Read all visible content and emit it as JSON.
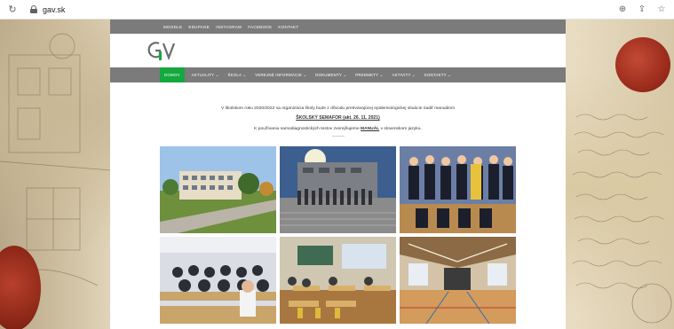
{
  "browser": {
    "url": "gav.sk",
    "icons": [
      "reload-icon",
      "lock-icon",
      "zoom-icon",
      "share-icon",
      "bookmark-star-icon"
    ]
  },
  "site": {
    "topbar_links": [
      "MOODLE",
      "EDUPAGE",
      "INSTAGRAM",
      "FACEBOOK",
      "KONTAKT"
    ],
    "logo_text": "GAV",
    "nav": [
      {
        "label": "DOMOV",
        "active": true
      },
      {
        "label": "AKTUALITY ⌄",
        "active": false
      },
      {
        "label": "ŠKOLA ⌄",
        "active": false
      },
      {
        "label": "VEREJNÉ INFORMÁCIE ⌄",
        "active": false
      },
      {
        "label": "DOKUMENTY ⌄",
        "active": false
      },
      {
        "label": "PREDMETY ⌄",
        "active": false
      },
      {
        "label": "AKTIVITY ⌄",
        "active": false
      },
      {
        "label": "KONTAKTY ⌄",
        "active": false
      }
    ],
    "announcement": {
      "line1": "V školskom roku 2020/2022 sa organizácia školy bude z dôvodu pretrvávajúcej epidemiologickej situácie riadiť manuálom",
      "line2": "ŠKOLSKÝ SEMAFOR (akt. 26. 11. 2021)",
      "line3_prefix": "K používaniu samodiagnostických testov zverejňujeme ",
      "line3_link": "MANUÁL",
      "line3_suffix": " v slovenskom jazyku."
    },
    "gallery": [
      "school-building-photo",
      "students-group-photo",
      "basketball-team-photo",
      "classroom-photo",
      "exam-room-photo",
      "gym-hall-photo"
    ]
  },
  "colors": {
    "nav_bg": "#7b7b7b",
    "nav_active": "#14a83e",
    "paper_bg": "#e2d6bb",
    "seal_red": "#9d2d1d"
  }
}
